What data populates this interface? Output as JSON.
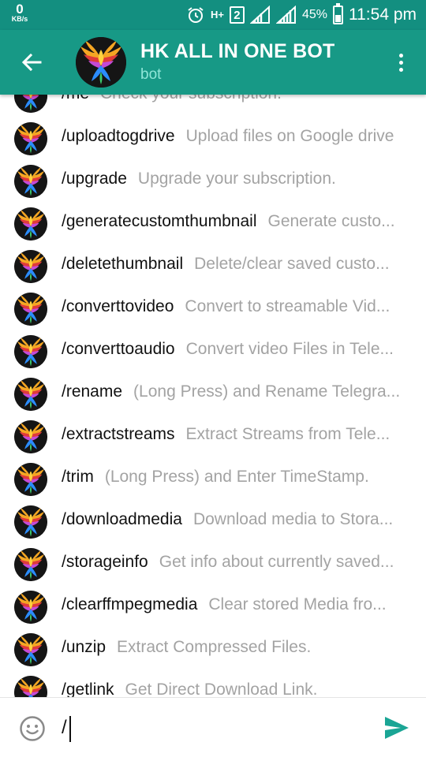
{
  "status_bar": {
    "net_speed_value": "0",
    "net_speed_unit": "KB/s",
    "sim_number": "2",
    "network_type": "H+",
    "battery_percent": "45%",
    "battery_level": 0.45,
    "time": "11:54 pm",
    "icons": [
      "alarm-icon",
      "network-type-icon",
      "sim-2-icon",
      "signal-icon",
      "signal-icon",
      "battery-icon"
    ]
  },
  "header": {
    "title": "HK ALL IN ONE BOT",
    "subtitle": "bot",
    "icons": [
      "back-arrow-icon",
      "bot-avatar",
      "more-options-icon"
    ]
  },
  "commands": [
    {
      "name": "/me",
      "description": "Check your subscription."
    },
    {
      "name": "/uploadtogdrive",
      "description": "Upload files on Google drive"
    },
    {
      "name": "/upgrade",
      "description": "Upgrade your subscription."
    },
    {
      "name": "/generatecustomthumbnail",
      "description": "Generate custo..."
    },
    {
      "name": "/deletethumbnail",
      "description": "Delete/clear saved custo..."
    },
    {
      "name": "/converttovideo",
      "description": "Convert to streamable Vid..."
    },
    {
      "name": "/converttoaudio",
      "description": "Convert video Files in Tele..."
    },
    {
      "name": "/rename",
      "description": "(Long Press) and Rename Telegra..."
    },
    {
      "name": "/extractstreams",
      "description": "Extract Streams from Tele..."
    },
    {
      "name": "/trim",
      "description": "(Long Press) and Enter TimeStamp."
    },
    {
      "name": "/downloadmedia",
      "description": "Download media to Stora..."
    },
    {
      "name": "/storageinfo",
      "description": "Get info about currently saved..."
    },
    {
      "name": "/clearffmpegmedia",
      "description": "Clear stored Media fro..."
    },
    {
      "name": "/unzip",
      "description": "Extract Compressed Files."
    },
    {
      "name": "/getlink",
      "description": "Get Direct Download Link."
    }
  ],
  "input": {
    "value": "/",
    "icons": [
      "emoji-icon",
      "send-icon"
    ]
  },
  "colors": {
    "status_bar": "#138f80",
    "header": "#179986",
    "subtitle": "#8fe6d8",
    "send_accent": "#1aa595",
    "command_text": "#111111",
    "description_text": "#a3a3a3"
  }
}
